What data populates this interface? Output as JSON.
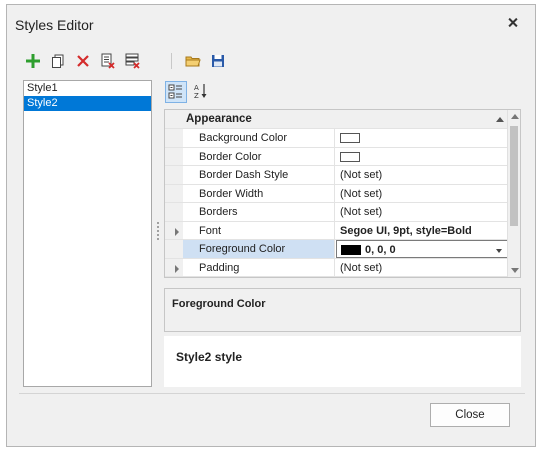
{
  "window": {
    "title": "Styles Editor"
  },
  "toolbar": {
    "buttons": [
      {
        "icon": "add-icon",
        "color": "#2e9e2e"
      },
      {
        "icon": "copy-icon",
        "color": "#444444"
      },
      {
        "icon": "delete-icon",
        "color": "#d42b2b"
      },
      {
        "icon": "remove-unused-icon",
        "color": "#d42b2b"
      },
      {
        "icon": "remove-all-icon",
        "color": "#d42b2b"
      },
      {
        "icon": "open-folder-icon",
        "color": "#d6a33a"
      },
      {
        "icon": "save-icon",
        "color": "#2a5aa8"
      }
    ]
  },
  "styles": {
    "items": [
      {
        "label": "Style1",
        "selected": false
      },
      {
        "label": "Style2",
        "selected": true
      }
    ]
  },
  "grid": {
    "view_buttons": [
      {
        "icon": "categorized-view-icon",
        "active": true
      },
      {
        "icon": "alphabetical-sort-icon",
        "active": false
      }
    ],
    "category": "Appearance",
    "properties": [
      {
        "name": "Background Color",
        "value": "",
        "swatch": "white",
        "expandable": false,
        "bold": false,
        "selected": false
      },
      {
        "name": "Border Color",
        "value": "",
        "swatch": "white",
        "expandable": false,
        "bold": false,
        "selected": false
      },
      {
        "name": "Border Dash Style",
        "value": "(Not set)",
        "swatch": "",
        "expandable": false,
        "bold": false,
        "selected": false
      },
      {
        "name": "Border Width",
        "value": "(Not set)",
        "swatch": "",
        "expandable": false,
        "bold": false,
        "selected": false
      },
      {
        "name": "Borders",
        "value": "(Not set)",
        "swatch": "",
        "expandable": false,
        "bold": false,
        "selected": false
      },
      {
        "name": "Font",
        "value": "Segoe UI, 9pt, style=Bold",
        "swatch": "",
        "expandable": true,
        "bold": true,
        "selected": false
      },
      {
        "name": "Foreground Color",
        "value": "0, 0, 0",
        "swatch": "black",
        "expandable": false,
        "bold": true,
        "selected": true
      },
      {
        "name": "Padding",
        "value": "(Not set)",
        "swatch": "",
        "expandable": true,
        "bold": false,
        "selected": false
      }
    ]
  },
  "description": {
    "title": "Foreground Color"
  },
  "preview": {
    "text": "Style2 style"
  },
  "footer": {
    "close_label": "Close"
  }
}
